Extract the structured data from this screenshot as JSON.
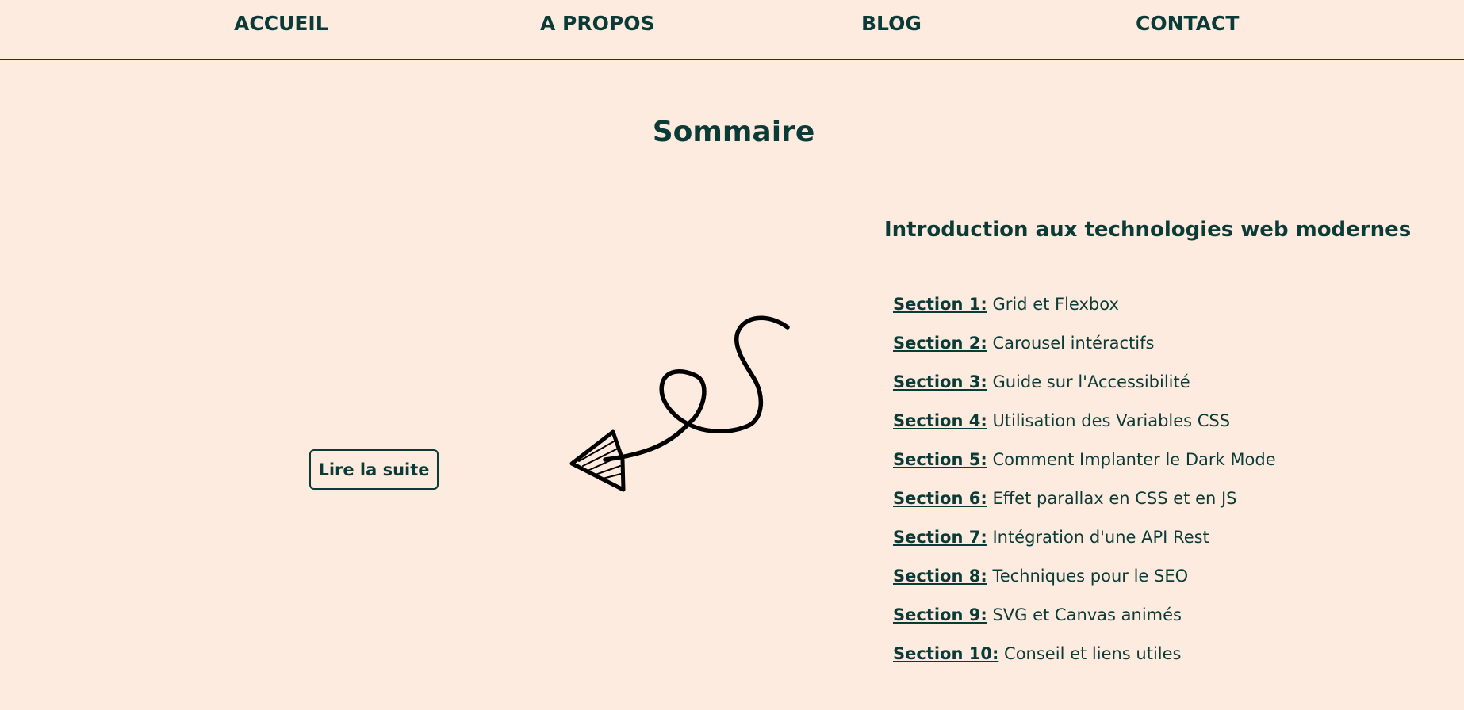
{
  "nav": {
    "items": [
      {
        "label": "ACCUEIL"
      },
      {
        "label": "A PROPOS"
      },
      {
        "label": "BLOG"
      },
      {
        "label": "CONTACT"
      }
    ]
  },
  "main": {
    "title": "Sommaire",
    "button_label": "Lire la suite",
    "arrow_icon": "curly-arrow-left-icon"
  },
  "toc": {
    "heading": "Introduction aux technologies web modernes",
    "sections": [
      {
        "label": "Section 1:",
        "text": " Grid et Flexbox"
      },
      {
        "label": "Section 2:",
        "text": " Carousel intéractifs"
      },
      {
        "label": "Section 3:",
        "text": " Guide sur l'Accessibilité"
      },
      {
        "label": "Section 4:",
        "text": " Utilisation des Variables CSS"
      },
      {
        "label": "Section 5:",
        "text": " Comment Implanter le Dark Mode"
      },
      {
        "label": "Section 6:",
        "text": " Effet parallax en CSS et en JS"
      },
      {
        "label": "Section 7:",
        "text": " Intégration d'une API Rest"
      },
      {
        "label": "Section 8:",
        "text": " Techniques pour le SEO"
      },
      {
        "label": "Section 9:",
        "text": " SVG et Canvas animés"
      },
      {
        "label": "Section 10:",
        "text": " Conseil et liens utiles"
      }
    ]
  },
  "colors": {
    "background": "#feebe0",
    "text": "#0b3b36",
    "arrow": "#000000"
  }
}
